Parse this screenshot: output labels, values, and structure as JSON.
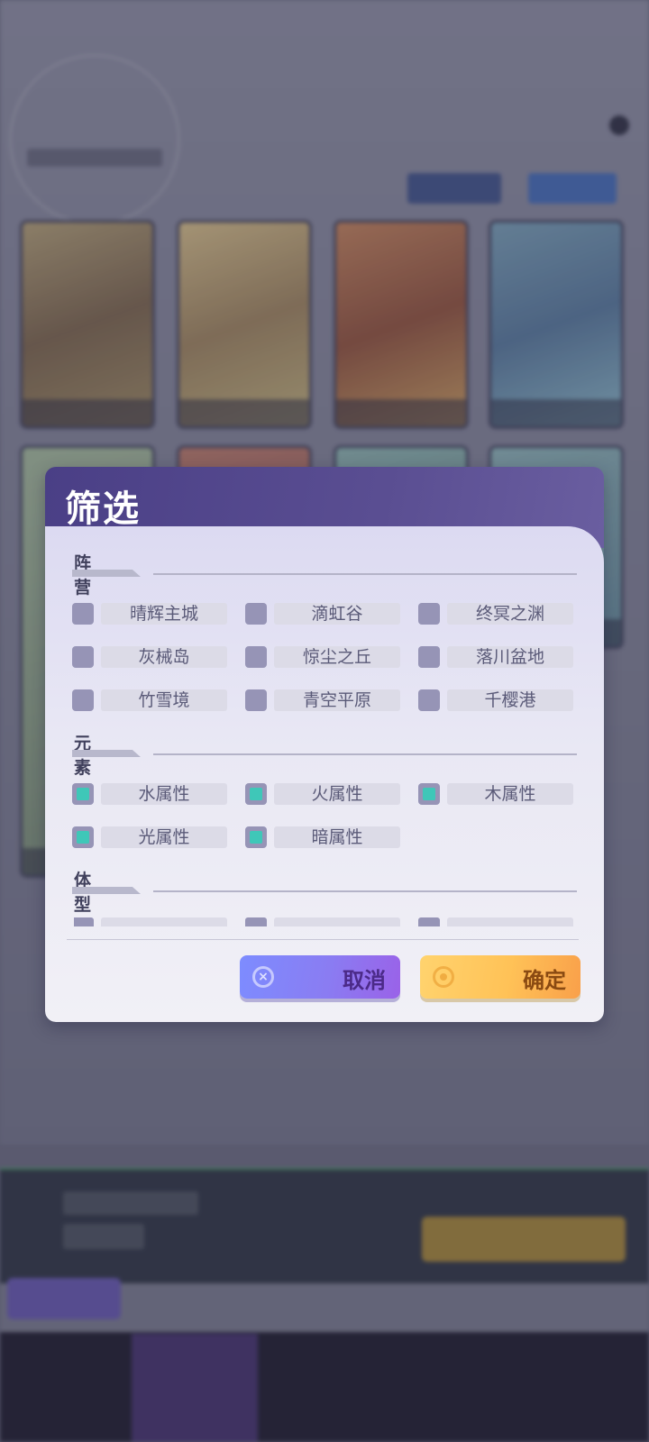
{
  "dialog": {
    "title": "筛选",
    "sections": [
      {
        "label": "阵营",
        "options": [
          {
            "label": "晴辉主城",
            "checked": false
          },
          {
            "label": "滴虹谷",
            "checked": false
          },
          {
            "label": "终冥之渊",
            "checked": false
          },
          {
            "label": "灰械岛",
            "checked": false
          },
          {
            "label": "惊尘之丘",
            "checked": false
          },
          {
            "label": "落川盆地",
            "checked": false
          },
          {
            "label": "竹雪境",
            "checked": false
          },
          {
            "label": "青空平原",
            "checked": false
          },
          {
            "label": "千樱港",
            "checked": false
          }
        ]
      },
      {
        "label": "元素",
        "options": [
          {
            "label": "水属性",
            "checked": true
          },
          {
            "label": "火属性",
            "checked": true
          },
          {
            "label": "木属性",
            "checked": true
          },
          {
            "label": "光属性",
            "checked": true
          },
          {
            "label": "暗属性",
            "checked": true
          }
        ]
      },
      {
        "label": "体型",
        "options": []
      }
    ],
    "cancel_label": "取消",
    "confirm_label": "确定"
  },
  "colors": {
    "header": "#4a3f86",
    "checkbox_unchecked": "#9694b6",
    "checkbox_checked": "#3fc7b8",
    "cancel_button": "#8a7cf2",
    "confirm_button": "#ffc257"
  },
  "icons": {
    "cancel": "close-circle-icon",
    "confirm": "target-circle-icon"
  }
}
